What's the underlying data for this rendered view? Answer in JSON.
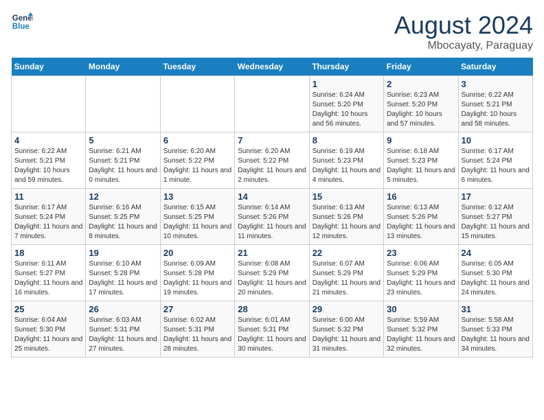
{
  "logo": {
    "line1": "General",
    "line2": "Blue"
  },
  "title": "August 2024",
  "subtitle": "Mbocayaty, Paraguay",
  "days_header": [
    "Sunday",
    "Monday",
    "Tuesday",
    "Wednesday",
    "Thursday",
    "Friday",
    "Saturday"
  ],
  "weeks": [
    [
      {
        "day": "",
        "info": ""
      },
      {
        "day": "",
        "info": ""
      },
      {
        "day": "",
        "info": ""
      },
      {
        "day": "",
        "info": ""
      },
      {
        "day": "1",
        "info": "Sunrise: 6:24 AM\nSunset: 5:20 PM\nDaylight: 10 hours and 56 minutes."
      },
      {
        "day": "2",
        "info": "Sunrise: 6:23 AM\nSunset: 5:20 PM\nDaylight: 10 hours and 57 minutes."
      },
      {
        "day": "3",
        "info": "Sunrise: 6:22 AM\nSunset: 5:21 PM\nDaylight: 10 hours and 58 minutes."
      }
    ],
    [
      {
        "day": "4",
        "info": "Sunrise: 6:22 AM\nSunset: 5:21 PM\nDaylight: 10 hours and 59 minutes."
      },
      {
        "day": "5",
        "info": "Sunrise: 6:21 AM\nSunset: 5:21 PM\nDaylight: 11 hours and 0 minutes."
      },
      {
        "day": "6",
        "info": "Sunrise: 6:20 AM\nSunset: 5:22 PM\nDaylight: 11 hours and 1 minute."
      },
      {
        "day": "7",
        "info": "Sunrise: 6:20 AM\nSunset: 5:22 PM\nDaylight: 11 hours and 2 minutes."
      },
      {
        "day": "8",
        "info": "Sunrise: 6:19 AM\nSunset: 5:23 PM\nDaylight: 11 hours and 4 minutes."
      },
      {
        "day": "9",
        "info": "Sunrise: 6:18 AM\nSunset: 5:23 PM\nDaylight: 11 hours and 5 minutes."
      },
      {
        "day": "10",
        "info": "Sunrise: 6:17 AM\nSunset: 5:24 PM\nDaylight: 11 hours and 6 minutes."
      }
    ],
    [
      {
        "day": "11",
        "info": "Sunrise: 6:17 AM\nSunset: 5:24 PM\nDaylight: 11 hours and 7 minutes."
      },
      {
        "day": "12",
        "info": "Sunrise: 6:16 AM\nSunset: 5:25 PM\nDaylight: 11 hours and 8 minutes."
      },
      {
        "day": "13",
        "info": "Sunrise: 6:15 AM\nSunset: 5:25 PM\nDaylight: 11 hours and 10 minutes."
      },
      {
        "day": "14",
        "info": "Sunrise: 6:14 AM\nSunset: 5:26 PM\nDaylight: 11 hours and 11 minutes."
      },
      {
        "day": "15",
        "info": "Sunrise: 6:13 AM\nSunset: 5:26 PM\nDaylight: 11 hours and 12 minutes."
      },
      {
        "day": "16",
        "info": "Sunrise: 6:13 AM\nSunset: 5:26 PM\nDaylight: 11 hours and 13 minutes."
      },
      {
        "day": "17",
        "info": "Sunrise: 6:12 AM\nSunset: 5:27 PM\nDaylight: 11 hours and 15 minutes."
      }
    ],
    [
      {
        "day": "18",
        "info": "Sunrise: 6:11 AM\nSunset: 5:27 PM\nDaylight: 11 hours and 16 minutes."
      },
      {
        "day": "19",
        "info": "Sunrise: 6:10 AM\nSunset: 5:28 PM\nDaylight: 11 hours and 17 minutes."
      },
      {
        "day": "20",
        "info": "Sunrise: 6:09 AM\nSunset: 5:28 PM\nDaylight: 11 hours and 19 minutes."
      },
      {
        "day": "21",
        "info": "Sunrise: 6:08 AM\nSunset: 5:29 PM\nDaylight: 11 hours and 20 minutes."
      },
      {
        "day": "22",
        "info": "Sunrise: 6:07 AM\nSunset: 5:29 PM\nDaylight: 11 hours and 21 minutes."
      },
      {
        "day": "23",
        "info": "Sunrise: 6:06 AM\nSunset: 5:29 PM\nDaylight: 11 hours and 23 minutes."
      },
      {
        "day": "24",
        "info": "Sunrise: 6:05 AM\nSunset: 5:30 PM\nDaylight: 11 hours and 24 minutes."
      }
    ],
    [
      {
        "day": "25",
        "info": "Sunrise: 6:04 AM\nSunset: 5:30 PM\nDaylight: 11 hours and 25 minutes."
      },
      {
        "day": "26",
        "info": "Sunrise: 6:03 AM\nSunset: 5:31 PM\nDaylight: 11 hours and 27 minutes."
      },
      {
        "day": "27",
        "info": "Sunrise: 6:02 AM\nSunset: 5:31 PM\nDaylight: 11 hours and 28 minutes."
      },
      {
        "day": "28",
        "info": "Sunrise: 6:01 AM\nSunset: 5:31 PM\nDaylight: 11 hours and 30 minutes."
      },
      {
        "day": "29",
        "info": "Sunrise: 6:00 AM\nSunset: 5:32 PM\nDaylight: 11 hours and 31 minutes."
      },
      {
        "day": "30",
        "info": "Sunrise: 5:59 AM\nSunset: 5:32 PM\nDaylight: 11 hours and 32 minutes."
      },
      {
        "day": "31",
        "info": "Sunrise: 5:58 AM\nSunset: 5:33 PM\nDaylight: 11 hours and 34 minutes."
      }
    ]
  ]
}
